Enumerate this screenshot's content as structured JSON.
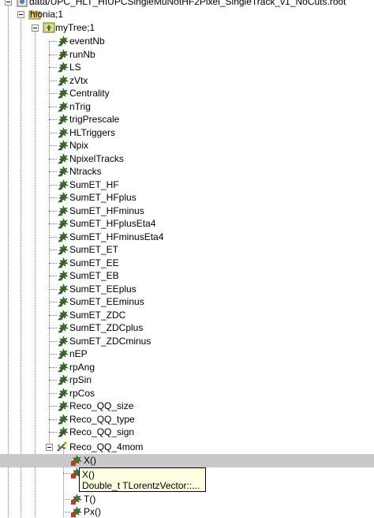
{
  "file": {
    "name": "data/UPC_HLT_HIUPCSingleMuNotHF2Pixel_SingleTrack_v1_NoCuts.root",
    "icon": "root-file-icon"
  },
  "dir": {
    "name": "hionia;1",
    "icon": "folder-icon"
  },
  "tree": {
    "name": "myTree;1",
    "icon": "ttree-icon"
  },
  "leaves": [
    "eventNb",
    "runNb",
    "LS",
    "zVtx",
    "Centrality",
    "nTrig",
    "trigPrescale",
    "HLTriggers",
    "Npix",
    "NpixelTracks",
    "Ntracks",
    "SumET_HF",
    "SumET_HFplus",
    "SumET_HFminus",
    "SumET_HFplusEta4",
    "SumET_HFminusEta4",
    "SumET_ET",
    "SumET_EE",
    "SumET_EB",
    "SumET_EEplus",
    "SumET_EEminus",
    "SumET_ZDC",
    "SumET_ZDCplus",
    "SumET_ZDCminus",
    "nEP",
    "rpAng",
    "rpSin",
    "rpCos",
    "Reco_QQ_size",
    "Reco_QQ_type",
    "Reco_QQ_sign"
  ],
  "branch": {
    "name": "Reco_QQ_4mom",
    "icon": "branch-element-icon"
  },
  "sub_leaves": [
    "X()",
    "X()",
    "T()",
    "Px()"
  ],
  "tooltip": {
    "line1": "X()",
    "line2": "Double_t TLorentzVector::..."
  },
  "colors": {
    "selection": "#c9c9c9",
    "tooltip_bg": "#ffffe1",
    "leaf_green": "#3f7a2a"
  }
}
